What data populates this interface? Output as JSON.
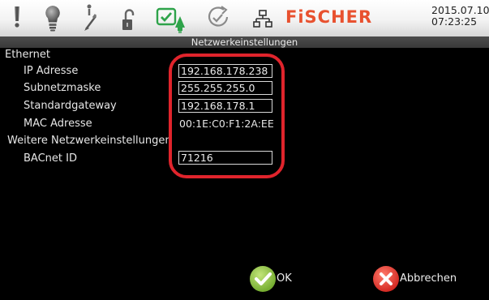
{
  "toolbar": {
    "icons": [
      "alert-icon",
      "lightbulb-icon",
      "service-tool-icon",
      "unlock-icon",
      "power-check-icon",
      "refresh-icon",
      "network-icon"
    ],
    "brand": "FiSCHER",
    "date": "2015.07.10",
    "time": "07:23:25",
    "colors": {
      "brand": "#e8512f",
      "check": "#2ea34a"
    }
  },
  "title": "Netzwerkeinstellungen",
  "sections": {
    "ethernet": "Ethernet",
    "weitere": "Weitere Netzwerkeinstellungen"
  },
  "fields": {
    "ip_label": "IP Adresse",
    "ip_value": "192.168.178.238",
    "subnet_label": "Subnetzmaske",
    "subnet_value": "255.255.255.0",
    "gateway_label": "Standardgateway",
    "gateway_value": "192.168.178.1",
    "mac_label": "MAC Adresse",
    "mac_value": "00:1E:C0:F1:2A:EE",
    "bacnet_label": "BACnet ID",
    "bacnet_value": "71216"
  },
  "buttons": {
    "ok": "OK",
    "cancel": "Abbrechen"
  },
  "colors": {
    "highlight": "#e0242c",
    "ok": "#8cc63e",
    "cancel": "#e5322d"
  }
}
